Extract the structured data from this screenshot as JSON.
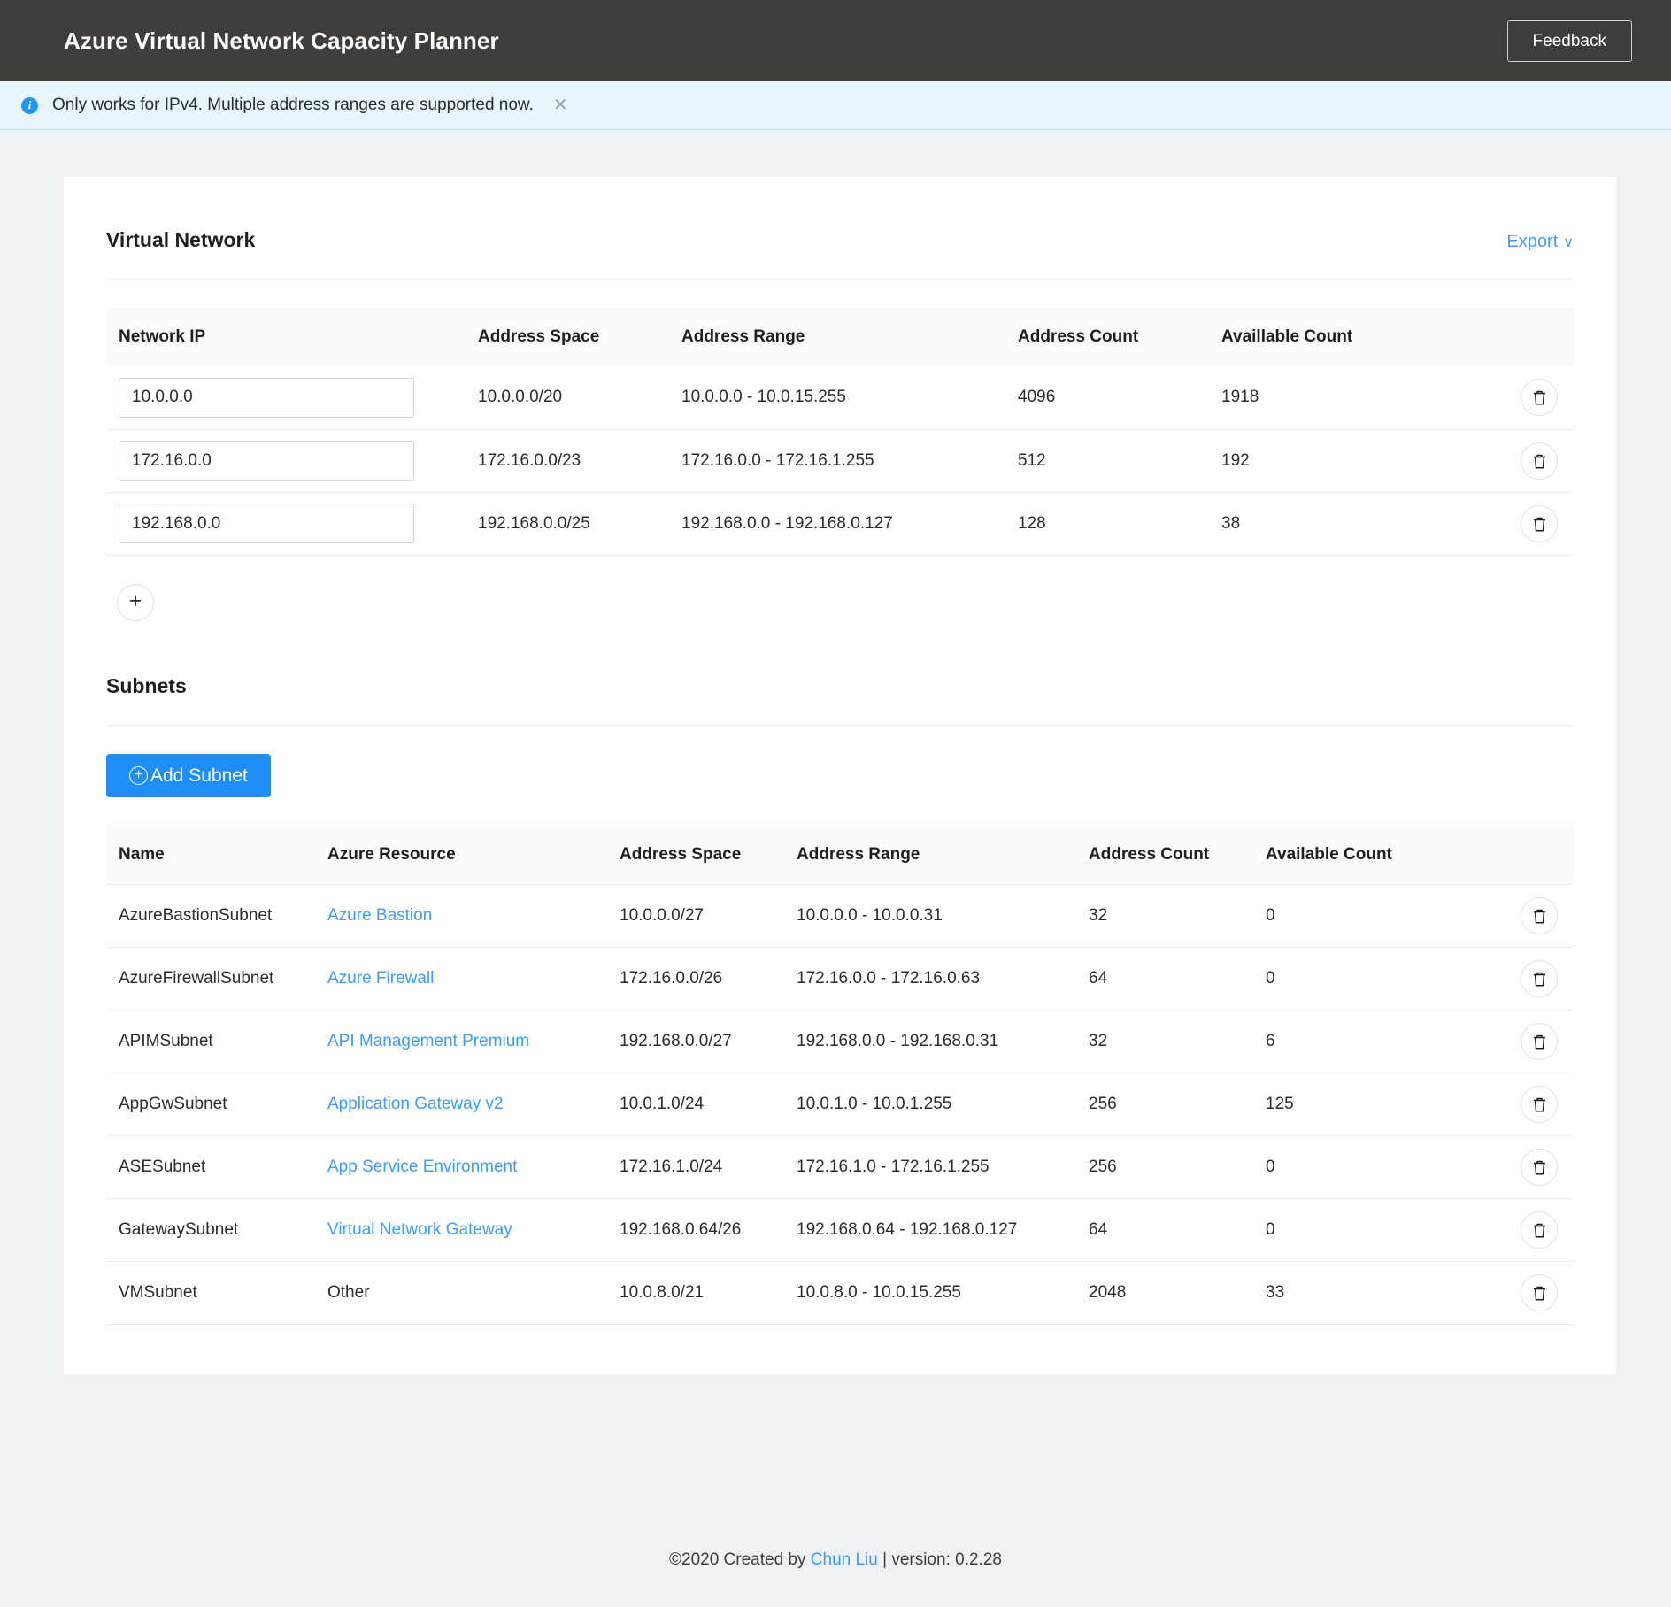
{
  "header": {
    "title": "Azure Virtual Network Capacity Planner",
    "feedback_label": "Feedback"
  },
  "alert": {
    "icon": "info-icon",
    "text": "Only works for IPv4. Multiple address ranges are supported now.",
    "close_label": "✕"
  },
  "virtual_network": {
    "section_title": "Virtual Network",
    "export_label": "Export",
    "export_chevron": "∨",
    "add_label": "+",
    "columns": [
      "Network IP",
      "Address Space",
      "Address Range",
      "Address Count",
      "Availlable Count"
    ],
    "rows": [
      {
        "network_ip": "10.0.0.0",
        "address_space": "10.0.0.0/20",
        "address_range": "10.0.0.0 - 10.0.15.255",
        "address_count": "4096",
        "available_count": "1918",
        "delete_icon": "trash-icon"
      },
      {
        "network_ip": "172.16.0.0",
        "address_space": "172.16.0.0/23",
        "address_range": "172.16.0.0 - 172.16.1.255",
        "address_count": "512",
        "available_count": "192",
        "delete_icon": "trash-icon"
      },
      {
        "network_ip": "192.168.0.0",
        "address_space": "192.168.0.0/25",
        "address_range": "192.168.0.0 - 192.168.0.127",
        "address_count": "128",
        "available_count": "38",
        "delete_icon": "trash-icon"
      }
    ]
  },
  "subnets": {
    "section_title": "Subnets",
    "add_subnet_label": "Add Subnet",
    "add_subnet_icon": "plus-circle-icon",
    "columns": [
      "Name",
      "Azure Resource",
      "Address Space",
      "Address Range",
      "Address Count",
      "Available Count"
    ],
    "rows": [
      {
        "name": "AzureBastionSubnet",
        "resource": "Azure Bastion",
        "resource_is_link": true,
        "address_space": "10.0.0.0/27",
        "address_range": "10.0.0.0 - 10.0.0.31",
        "address_count": "32",
        "available_count": "0",
        "delete_icon": "trash-icon"
      },
      {
        "name": "AzureFirewallSubnet",
        "resource": "Azure Firewall",
        "resource_is_link": true,
        "address_space": "172.16.0.0/26",
        "address_range": "172.16.0.0 - 172.16.0.63",
        "address_count": "64",
        "available_count": "0",
        "delete_icon": "trash-icon"
      },
      {
        "name": "APIMSubnet",
        "resource": "API Management Premium",
        "resource_is_link": true,
        "address_space": "192.168.0.0/27",
        "address_range": "192.168.0.0 - 192.168.0.31",
        "address_count": "32",
        "available_count": "6",
        "delete_icon": "trash-icon"
      },
      {
        "name": "AppGwSubnet",
        "resource": "Application Gateway v2",
        "resource_is_link": true,
        "address_space": "10.0.1.0/24",
        "address_range": "10.0.1.0 - 10.0.1.255",
        "address_count": "256",
        "available_count": "125",
        "delete_icon": "trash-icon"
      },
      {
        "name": "ASESubnet",
        "resource": "App Service Environment",
        "resource_is_link": true,
        "address_space": "172.16.1.0/24",
        "address_range": "172.16.1.0 - 172.16.1.255",
        "address_count": "256",
        "available_count": "0",
        "delete_icon": "trash-icon"
      },
      {
        "name": "GatewaySubnet",
        "resource": "Virtual Network Gateway",
        "resource_is_link": true,
        "address_space": "192.168.0.64/26",
        "address_range": "192.168.0.64 - 192.168.0.127",
        "address_count": "64",
        "available_count": "0",
        "delete_icon": "trash-icon"
      },
      {
        "name": "VMSubnet",
        "resource": "Other",
        "resource_is_link": false,
        "address_space": "10.0.8.0/21",
        "address_range": "10.0.8.0 - 10.0.15.255",
        "address_count": "2048",
        "available_count": "33",
        "delete_icon": "trash-icon"
      }
    ]
  },
  "footer": {
    "prefix": "©2020 Created by ",
    "author": "Chun Liu",
    "suffix": " | version: 0.2.28"
  },
  "colors": {
    "navbar_bg": "#3f3c3a",
    "page_bg": "#eff1f4",
    "accent_link": "#3e9bff",
    "primary_button": "#1f8ff7",
    "alert_bg": "#e7f6fd"
  }
}
